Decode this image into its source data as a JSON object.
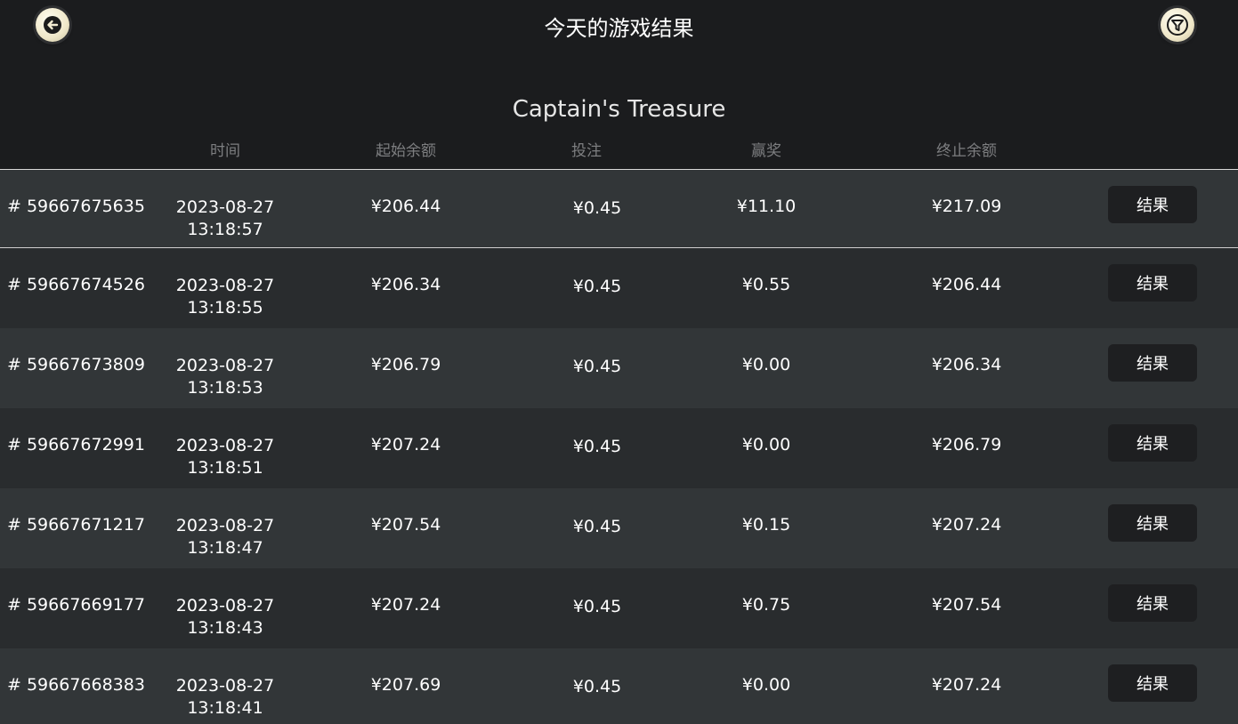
{
  "header": {
    "title": "今天的游戏结果",
    "back_icon": "arrow-left-icon",
    "filter_icon": "filter-icon"
  },
  "game": {
    "name": "Captain's Treasure"
  },
  "table": {
    "columns": [
      "时间",
      "起始余额",
      "投注",
      "赢奖",
      "终止余额"
    ],
    "result_label": "结果",
    "rows": [
      {
        "id": "# 59667675635",
        "date": "2023-08-27",
        "time": "13:18:57",
        "start": "¥206.44",
        "bet": "¥0.45",
        "win": "¥11.10",
        "end": "¥217.09"
      },
      {
        "id": "# 59667674526",
        "date": "2023-08-27",
        "time": "13:18:55",
        "start": "¥206.34",
        "bet": "¥0.45",
        "win": "¥0.55",
        "end": "¥206.44"
      },
      {
        "id": "# 59667673809",
        "date": "2023-08-27",
        "time": "13:18:53",
        "start": "¥206.79",
        "bet": "¥0.45",
        "win": "¥0.00",
        "end": "¥206.34"
      },
      {
        "id": "# 59667672991",
        "date": "2023-08-27",
        "time": "13:18:51",
        "start": "¥207.24",
        "bet": "¥0.45",
        "win": "¥0.00",
        "end": "¥206.79"
      },
      {
        "id": "# 59667671217",
        "date": "2023-08-27",
        "time": "13:18:47",
        "start": "¥207.54",
        "bet": "¥0.45",
        "win": "¥0.15",
        "end": "¥207.24"
      },
      {
        "id": "# 59667669177",
        "date": "2023-08-27",
        "time": "13:18:43",
        "start": "¥207.24",
        "bet": "¥0.45",
        "win": "¥0.75",
        "end": "¥207.54"
      },
      {
        "id": "# 59667668383",
        "date": "2023-08-27",
        "time": "13:18:41",
        "start": "¥207.69",
        "bet": "¥0.45",
        "win": "¥0.00",
        "end": "¥207.24"
      }
    ]
  }
}
